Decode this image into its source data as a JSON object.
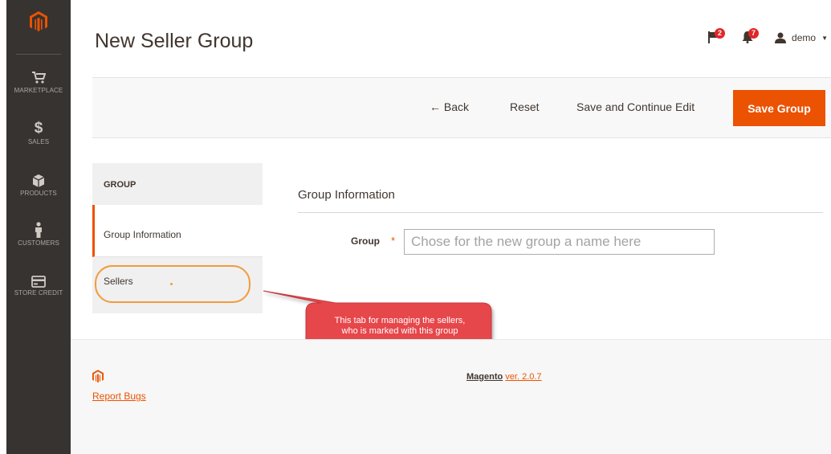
{
  "sidebar": {
    "items": [
      {
        "label": "MARKETPLACE",
        "icon": "cart-icon"
      },
      {
        "label": "SALES",
        "icon": "dollar-icon"
      },
      {
        "label": "PRODUCTS",
        "icon": "box-icon"
      },
      {
        "label": "CUSTOMERS",
        "icon": "person-icon"
      },
      {
        "label": "STORE CREDIT",
        "icon": "card-icon"
      }
    ]
  },
  "header": {
    "title": "New Seller Group",
    "flags_count": "2",
    "notifications_count": "7",
    "user": "demo"
  },
  "toolbar": {
    "back_label": "← Back",
    "reset_label": "Reset",
    "save_continue_label": "Save and Continue Edit",
    "save_label": "Save Group"
  },
  "tabs": {
    "heading": "GROUP",
    "items": [
      {
        "label": "Group Information",
        "active": true
      },
      {
        "label": "Sellers",
        "active": false
      }
    ]
  },
  "form": {
    "section_title": "Group Information",
    "group_label": "Group",
    "required_mark": "*",
    "group_placeholder": "Chose for the new group a name here"
  },
  "callout": {
    "line1": "This tab for managing the sellers,",
    "line2": "who is marked with this group"
  },
  "footer": {
    "report_bugs": "Report Bugs",
    "brand": "Magento",
    "version": "ver. 2.0.7"
  },
  "colors": {
    "accent": "#eb5202",
    "sidebar_bg": "#373330",
    "badge": "#e22626",
    "callout": "#e6474c"
  }
}
